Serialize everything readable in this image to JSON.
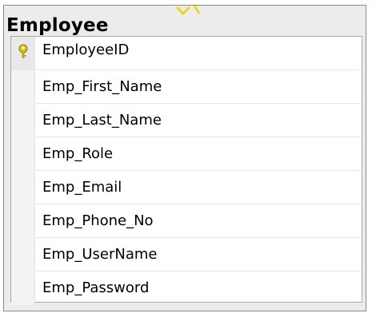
{
  "table": {
    "title": "Employee",
    "columns": [
      {
        "name": "EmployeeID",
        "primary_key": true,
        "icon": "key-icon"
      },
      {
        "name": "Emp_First_Name",
        "primary_key": false
      },
      {
        "name": "Emp_Last_Name",
        "primary_key": false
      },
      {
        "name": "Emp_Role",
        "primary_key": false
      },
      {
        "name": "Emp_Email",
        "primary_key": false
      },
      {
        "name": "Emp_Phone_No",
        "primary_key": false
      },
      {
        "name": "Emp_UserName",
        "primary_key": false
      },
      {
        "name": "Emp_Password",
        "primary_key": false
      }
    ]
  },
  "colors": {
    "header_background": "#ececec",
    "border": "#8a8a8a",
    "key_icon": "#d9c41a",
    "decorative_stroke": "#f2d31b"
  }
}
